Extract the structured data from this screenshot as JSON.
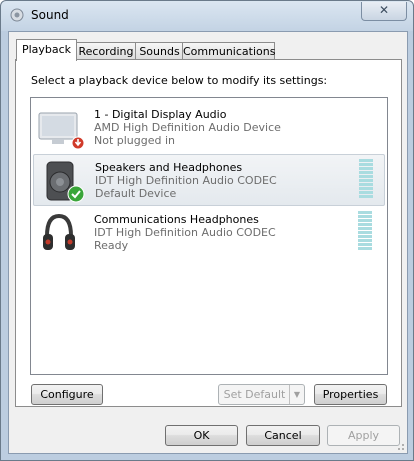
{
  "window": {
    "title": "Sound",
    "close_label": "✕"
  },
  "tabs": [
    {
      "label": "Playback",
      "active": true
    },
    {
      "label": "Recording",
      "active": false
    },
    {
      "label": "Sounds",
      "active": false
    },
    {
      "label": "Communications",
      "active": false
    }
  ],
  "playback": {
    "instruction": "Select a playback device below to modify its settings:",
    "devices": [
      {
        "name": "1 - Digital Display Audio",
        "driver": "AMD High Definition Audio Device",
        "status": "Not plugged in",
        "icon": "monitor-icon",
        "badge": "unplugged-badge-icon",
        "selected": false,
        "meter": false
      },
      {
        "name": "Speakers and Headphones",
        "driver": "IDT High Definition Audio CODEC",
        "status": "Default Device",
        "icon": "speaker-icon",
        "badge": "default-check-icon",
        "selected": true,
        "meter": true
      },
      {
        "name": "Communications Headphones",
        "driver": "IDT High Definition Audio CODEC",
        "status": "Ready",
        "icon": "headphones-icon",
        "badge": "",
        "selected": false,
        "meter": true
      }
    ],
    "configure_label": "Configure",
    "set_default_label": "Set Default",
    "properties_label": "Properties"
  },
  "footer": {
    "ok_label": "OK",
    "cancel_label": "Cancel",
    "apply_label": "Apply"
  },
  "colors": {
    "meter": "#a9dce0",
    "check": "#3aa53a",
    "unplugged": "#d03a2a"
  }
}
